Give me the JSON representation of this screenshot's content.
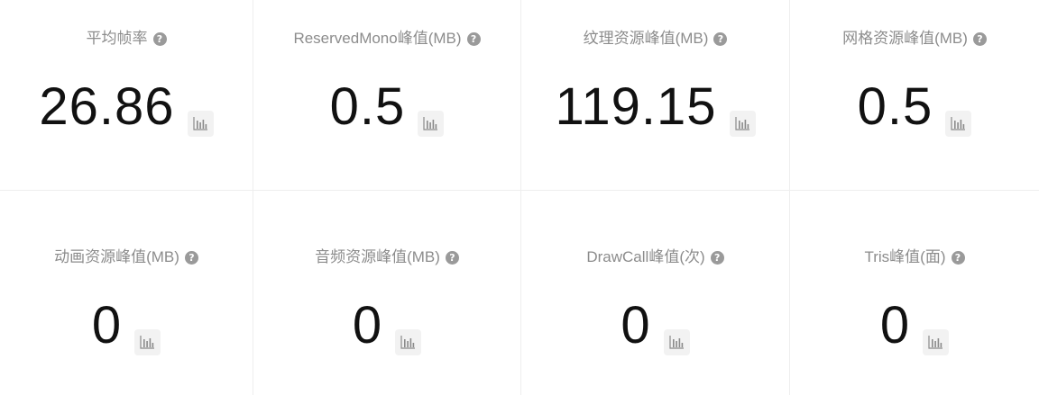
{
  "metrics": [
    {
      "label": "平均帧率",
      "value": "26.86",
      "help_icon": "question-circle-icon",
      "chart_icon": "bar-chart-icon"
    },
    {
      "label": "ReservedMono峰值(MB)",
      "value": "0.5",
      "help_icon": "question-circle-icon",
      "chart_icon": "bar-chart-icon"
    },
    {
      "label": "纹理资源峰值(MB)",
      "value": "119.15",
      "help_icon": "question-circle-icon",
      "chart_icon": "bar-chart-icon"
    },
    {
      "label": "网格资源峰值(MB)",
      "value": "0.5",
      "help_icon": "question-circle-icon",
      "chart_icon": "bar-chart-icon"
    },
    {
      "label": "动画资源峰值(MB)",
      "value": "0",
      "help_icon": "question-circle-icon",
      "chart_icon": "bar-chart-icon"
    },
    {
      "label": "音频资源峰值(MB)",
      "value": "0",
      "help_icon": "question-circle-icon",
      "chart_icon": "bar-chart-icon"
    },
    {
      "label": "DrawCall峰值(次)",
      "value": "0",
      "help_icon": "question-circle-icon",
      "chart_icon": "bar-chart-icon"
    },
    {
      "label": "Tris峰值(面)",
      "value": "0",
      "help_icon": "question-circle-icon",
      "chart_icon": "bar-chart-icon"
    }
  ],
  "help_glyph": "?",
  "colors": {
    "label": "#8c8c8c",
    "value": "#111111",
    "help_icon_bg": "#9a9a9a",
    "chart_button_bg": "#f2f2f2",
    "chart_icon": "#8a8a8a",
    "divider": "#eeeeee"
  }
}
